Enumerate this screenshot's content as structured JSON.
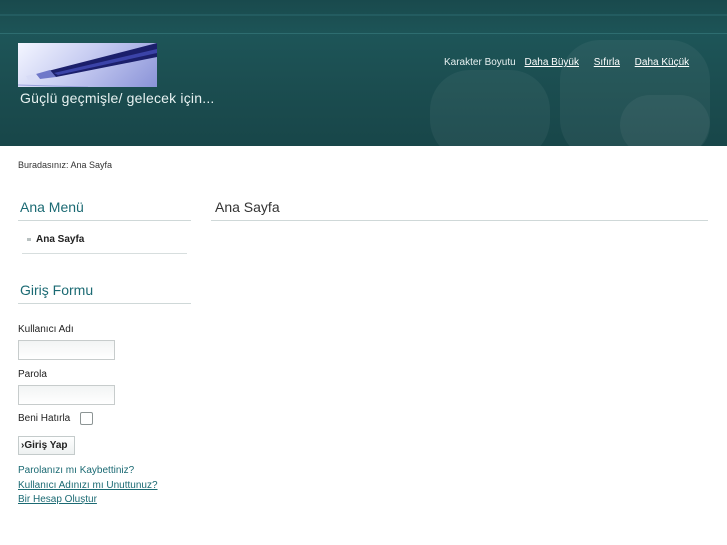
{
  "header": {
    "tagline": "Güçlü geçmişle/ gelecek için...",
    "logo_icon": "fountain-pen-icon",
    "font_size": {
      "label": "Karakter Boyutu",
      "bigger": "Daha Büyük",
      "reset": "Sıfırla",
      "smaller": "Daha Küçük"
    }
  },
  "breadcrumb": "Buradasınız: Ana Sayfa",
  "main_menu": {
    "title": "Ana Menü",
    "items": [
      {
        "label": "Ana Sayfa"
      }
    ]
  },
  "login": {
    "title": "Giriş Formu",
    "username_label": "Kullanıcı Adı",
    "username_value": "",
    "password_label": "Parola",
    "password_value": "",
    "remember_label": "Beni Hatırla",
    "remember_checked": false,
    "submit_label": "Giriş Yap",
    "links": {
      "forgot_password": "Parolanızı mı Kaybettiniz?",
      "forgot_username": "Kullanıcı Adınızı mı Unuttunuz?",
      "register": "Bir Hesap Oluştur"
    }
  },
  "content": {
    "title": "Ana Sayfa"
  },
  "colors": {
    "header_bg": "#1b4d50",
    "accent": "#1b6a73"
  }
}
